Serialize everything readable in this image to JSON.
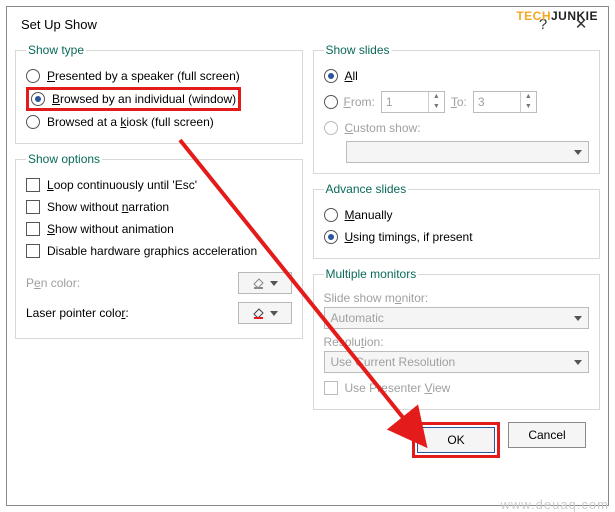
{
  "title": "Set Up Show",
  "groups": {
    "show_type": {
      "legend": "Show type",
      "opts": {
        "presented": "Presented by a speaker (full screen)",
        "browsed_ind": "Browsed by an individual (window)",
        "browsed_kiosk": "Browsed at a kiosk (full screen)"
      },
      "selected": "browsed_ind"
    },
    "show_options": {
      "legend": "Show options",
      "opts": {
        "loop": "Loop continuously until 'Esc'",
        "no_narration": "Show without narration",
        "no_animation": "Show without animation",
        "no_hw": "Disable hardware graphics acceleration"
      },
      "pen_label": "Pen color:",
      "laser_label": "Laser pointer color:"
    },
    "show_slides": {
      "legend": "Show slides",
      "all": "All",
      "from": "From:",
      "to": "To:",
      "from_val": "1",
      "to_val": "3",
      "custom": "Custom show:",
      "selected": "all"
    },
    "advance": {
      "legend": "Advance slides",
      "manual": "Manually",
      "timings": "Using timings, if present",
      "selected": "timings"
    },
    "monitors": {
      "legend": "Multiple monitors",
      "monitor_label": "Slide show monitor:",
      "monitor_value": "Automatic",
      "res_label": "Resolution:",
      "res_value": "Use Current Resolution",
      "presenter": "Use Presenter View"
    }
  },
  "buttons": {
    "ok": "OK",
    "cancel": "Cancel"
  },
  "branding": {
    "logo1": "TECH",
    "logo2": "JUNKIE",
    "watermark": "www.deuaq.com"
  }
}
